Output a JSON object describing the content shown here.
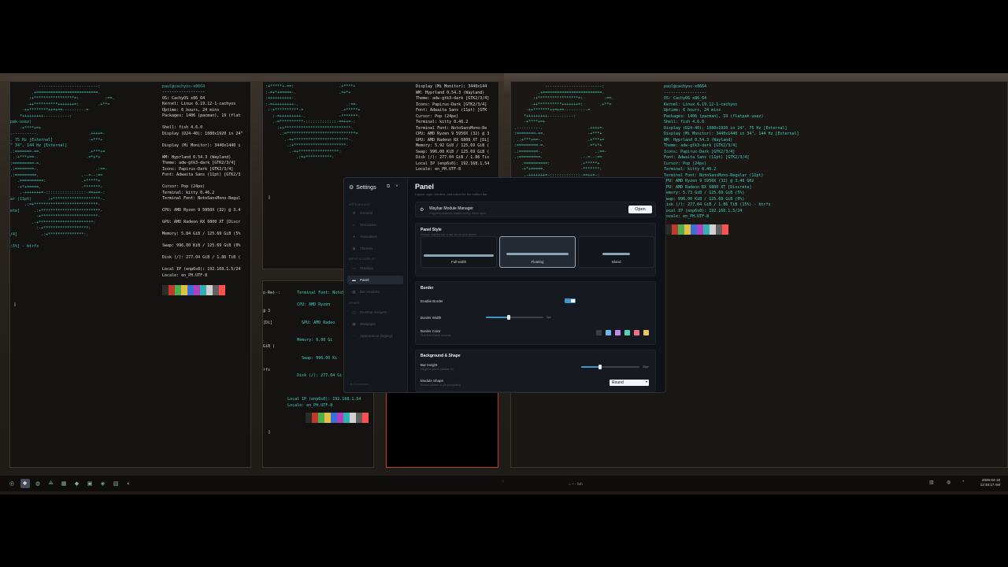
{
  "terminals": {
    "t1": {
      "ascii": "            -------------------------:\n         .+==========================.\n        :+*****************=:           :==.\n       -++**********+++++++=:        .+**=\n     -++********++=+==----------=\n    *+++++++++-----------:\npak-usez)\n    -+****+=+\n.----------.                     .++++=-\n. 75 Hz [External]               -+***+\n\" 34\", 144 Hz [External]\n.:=======-==.                    .+***+=\n .:+***+==-.                    .=*+*+\n:=========-=.\n.:========-.                        .:==-\n.:=========.                  .--=--:==\n   .==========:               .+*****+\n   -+*+=====.                 -*******:\n    .-+++++++=-:::::::::::::::::-==++=-:\nar (11pt)       :+********************-.\n      .:=+***************************-\nete]      .:+*************************-\n           -+************************-\n         .-+***********************:\n           :-+*******************:\n/4]          .:+***************:.\n\n:5%] - btrfs",
      "user": "paul@cachyos-x8664",
      "info": "------------------\nOS: CachyOS x86_64\nKernel: Linux 6.19.12-1-cachyos\nUptime: 6 hours, 24 mins\nPackages: 1406 (pacman), 19 (flat\n\nShell: fish 4.6.0\nDisplay (D24-40): 1080x1920 in 24\"\n\nDisplay (Mi Monitor): 3440x1440 i\n\nWM: Hyprland 0.54.3 (Wayland)\nTheme: adw-gtk3-dark [GTK2/3/4]\nIcons: Papirus-Dark [GTK2/3/4]\nFont: Adwaita Sans (11pt) [GTK2/3\n\nCursor: Pop (24px)\nTerminal: kitty 0.46.2\nTerminal Font: NotoSansMono-Regul\n\nCPU: AMD Ryzen 9 5950X (32) @ 3.4\n\nGPU: AMD Radeon RX 6800 XT [Discr\n\nMemory: 5.84 GiB / 125.69 GiB (5%\n\nSwap: 996.00 KiB / 125.69 GiB (0%\n\nDisk (/): 277.04 GiB / 1.86 TiB (\n\nLocal IP (enp6s0): 192.168.1.5/24\nLocale: en_PH.UTF-8"
    },
    "t2": {
      "ascii": ":+*****+-==:                   .+****+\n:-=+*+=====-.                  .=+*+\n:++++++++++-.\n:-=+++++++++-.                    .:==-\n :-+**********-=                .+*****+\n   :-=+++++++++-.              -*******:\n   .-=**********-:::::::::::::-==++=-:\n     :++****************************-\n      .:=*****************************=\n        .-=+***********************-.\n         .:+**********************-\n          .-=+*****************:\n             .:=+***********:",
      "info": "Display (Mi Monitor): 3440x144\nWM: Hyprland 0.54.3 (Wayland)\nTheme: adw-gtk3-dark [GTK2/3/4]\nIcons: Papirus-Dark [GTK2/3/4]\nFont: Adwaita Sans (11pt) [GTK\nCursor: Pop (24px)\nTerminal: kitty 0.46.2\nTerminal Font: NotoSansMono-Re\nCPU: AMD Ryzen 9 5950X (32) @ 3\nGPU: AMD Radeon RX 6800 XT [Di]\nMemory: 5.92 GiB / 125.69 GiB (\nSwap: 996.00 KiB / 125.69 GiB (\nDisk (/): 277.04 GiB / 1.86 Tis\nLocal IP (enp6s0): 192.168.1.54\nLocale: en_PH.UTF-8"
    },
    "t3": {
      "left": "o-Re)\n\n\n@ 3\n\n[Di]\n\n\n\nGiB )\n\n\n\nrfs",
      "info": "---:       Terminal Font: NotoSansMo\n\n           CPU: AMD Ryzen\n\n\n             GPU: AMD Radeo\n\n\n           Memory: 6.00 Gi\n\n\n             Swap: 996.00 Ki\n\n\n           Disk (/): 277.04 Gi\n\n\n\n       Local IP (enp6s0): 192.168.1.54\n       Locale: en_PH.UTF-8"
    },
    "t4": {
      "ascii": "             ------------------------:\n          .+=========================.\n        :+*****************=:         :==.\n       -++**********+++++++=:       .+**=\n     -++*******++=+==----------=\n    *+++++++++-----------:\n    -+****+=+\n.----------.                   .++++=-\n:========-==.                  -+***+\n .:+***+==-.                   .+***+=\n:=========-=.                  .=*+*+\n.:========-.                      .:==-\n.:=========.                .--=--:==\n   .==========:             .+*****+\n   -+*+=====.               -*******:\n    .-+++++++=-:::::::::::::-==++=-:\n      :=+***************************-",
      "info": "paul@cachyos-x8664\n------------------\nOS: CachyOS x86_64\nKernel: Linux 6.19.12-1-cachyos\nUptime: 6 hours, 24 mins\nPackages: 1406 (pacman), 19 (flatpak-usez)\nShell: fish 4.6.0\nDisplay (D24-40): 1080x1920 in 24\", 75 Hz [External]\nDisplay (Mi Monitor): 3440x1440 in 34\", 144 Hz [External]\nWM: Hyprland 0.54.3 (Wayland)\nTheme: adw-gtk3-dark [GTK2/3/4]\nIcons: Papirus-Dark [GTK2/3/4]\nFont: Adwaita Sans (11pt) [GTK2/3/4]\nCursor: Pop (24px)\nTerminal: kitty 0.46.2\nTerminal Font: NotoSansMono-Regular (11pt)\nCPU: AMD Ryzen 9 5950X (32) @ 3.40 GHz\nGPU: AMD Radeon RX 6800 XT [Discrete]\nMemory: 5.73 GiB / 125.69 GiB (5%)\nSwap: 996.00 KiB / 125.69 GiB (0%)\nDisk (/): 277.04 GiB / 1.86 TiB (15%) - btrfs\nLocal IP (enp6s0): 192.168.1.5/24\nLocale: en_PH.UTF-8"
    },
    "prompt_glyph": "▯",
    "palette_colors": [
      "#2b2b2b",
      "#c0392b",
      "#4caf50",
      "#e0c040",
      "#3a6fd8",
      "#b040c0",
      "#30b0b0",
      "#d0d0d0",
      "#606060",
      "#ff5050",
      "#70ff70",
      "#ffff70",
      "#70a0ff",
      "#ff70ff",
      "#70ffff",
      "#ffffff"
    ]
  },
  "settings": {
    "title": "Settings",
    "win_pin": "⧉",
    "win_close": "×",
    "sidebar": {
      "sec_appearance": "Appearance",
      "items_a": [
        {
          "label": "General",
          "icon": "⚙"
        },
        {
          "label": "Decoration",
          "icon": "◐"
        },
        {
          "label": "Animations",
          "icon": "✦"
        },
        {
          "label": "Themes",
          "icon": "◉"
        }
      ],
      "sec_input": "Input & Display",
      "items_b": [
        {
          "label": "Displays",
          "icon": "▭"
        },
        {
          "label": "Panel",
          "icon": "▬"
        },
        {
          "label": "Bar Modules",
          "icon": "▦"
        }
      ],
      "sec_other": "Other",
      "items_c": [
        {
          "label": "Desktop Widgets",
          "icon": "◫"
        },
        {
          "label": "Wallpaper",
          "icon": "▣"
        },
        {
          "label": "Appearance (legacy)",
          "icon": "◌"
        }
      ],
      "footer": "● Connected"
    },
    "panel": {
      "title": "Panel",
      "subtitle": "Layout, style, borders, and colors for the bottom bar",
      "module_manager": {
        "title": "Waybar Module Manager",
        "subtitle": "Drag drop enables, drawer config, theme sync",
        "button": "Open",
        "icon": "⚙"
      },
      "style": {
        "title": "Panel Style",
        "subtitle": "Choose how the bar is laid out on your screen",
        "options": [
          {
            "label": "Full-width",
            "selected": false
          },
          {
            "label": "Floating",
            "selected": true
          },
          {
            "label": "Island",
            "selected": false
          }
        ]
      },
      "border": {
        "title": "Border",
        "enable_label": "Enable Border",
        "width_label": "Border Width",
        "width_value": "2px",
        "width_fraction": 0.4,
        "color_label": "Border Color",
        "color_sub": "Pick from theme accents",
        "swatches": [
          "#3a3f46",
          "#6fb8e8",
          "#c08be8",
          "#58d0b8",
          "#ef6f8c",
          "#e8c860"
        ]
      },
      "background": {
        "title": "Background & Shape",
        "height_label": "Bar Height",
        "height_sub": "Height in pixels (default 30)",
        "height_value": "30px",
        "height_fraction": 0.32,
        "shape_label": "Module Shape",
        "shape_sub": "Round corners or pill (elongated)",
        "shape_value": "Round"
      }
    }
  },
  "taskbar": {
    "workspaces": [
      "◎",
      "❖",
      "◍",
      "⟁",
      "▦",
      "◆",
      "▣",
      "◈",
      "▧",
      "◐"
    ],
    "center_text": "⌂ ~ - fish",
    "center_dot": "◌",
    "tray": [
      "▥",
      "◍",
      "◔"
    ],
    "date": "2026-04-18",
    "time": "12:48:17 AM"
  }
}
